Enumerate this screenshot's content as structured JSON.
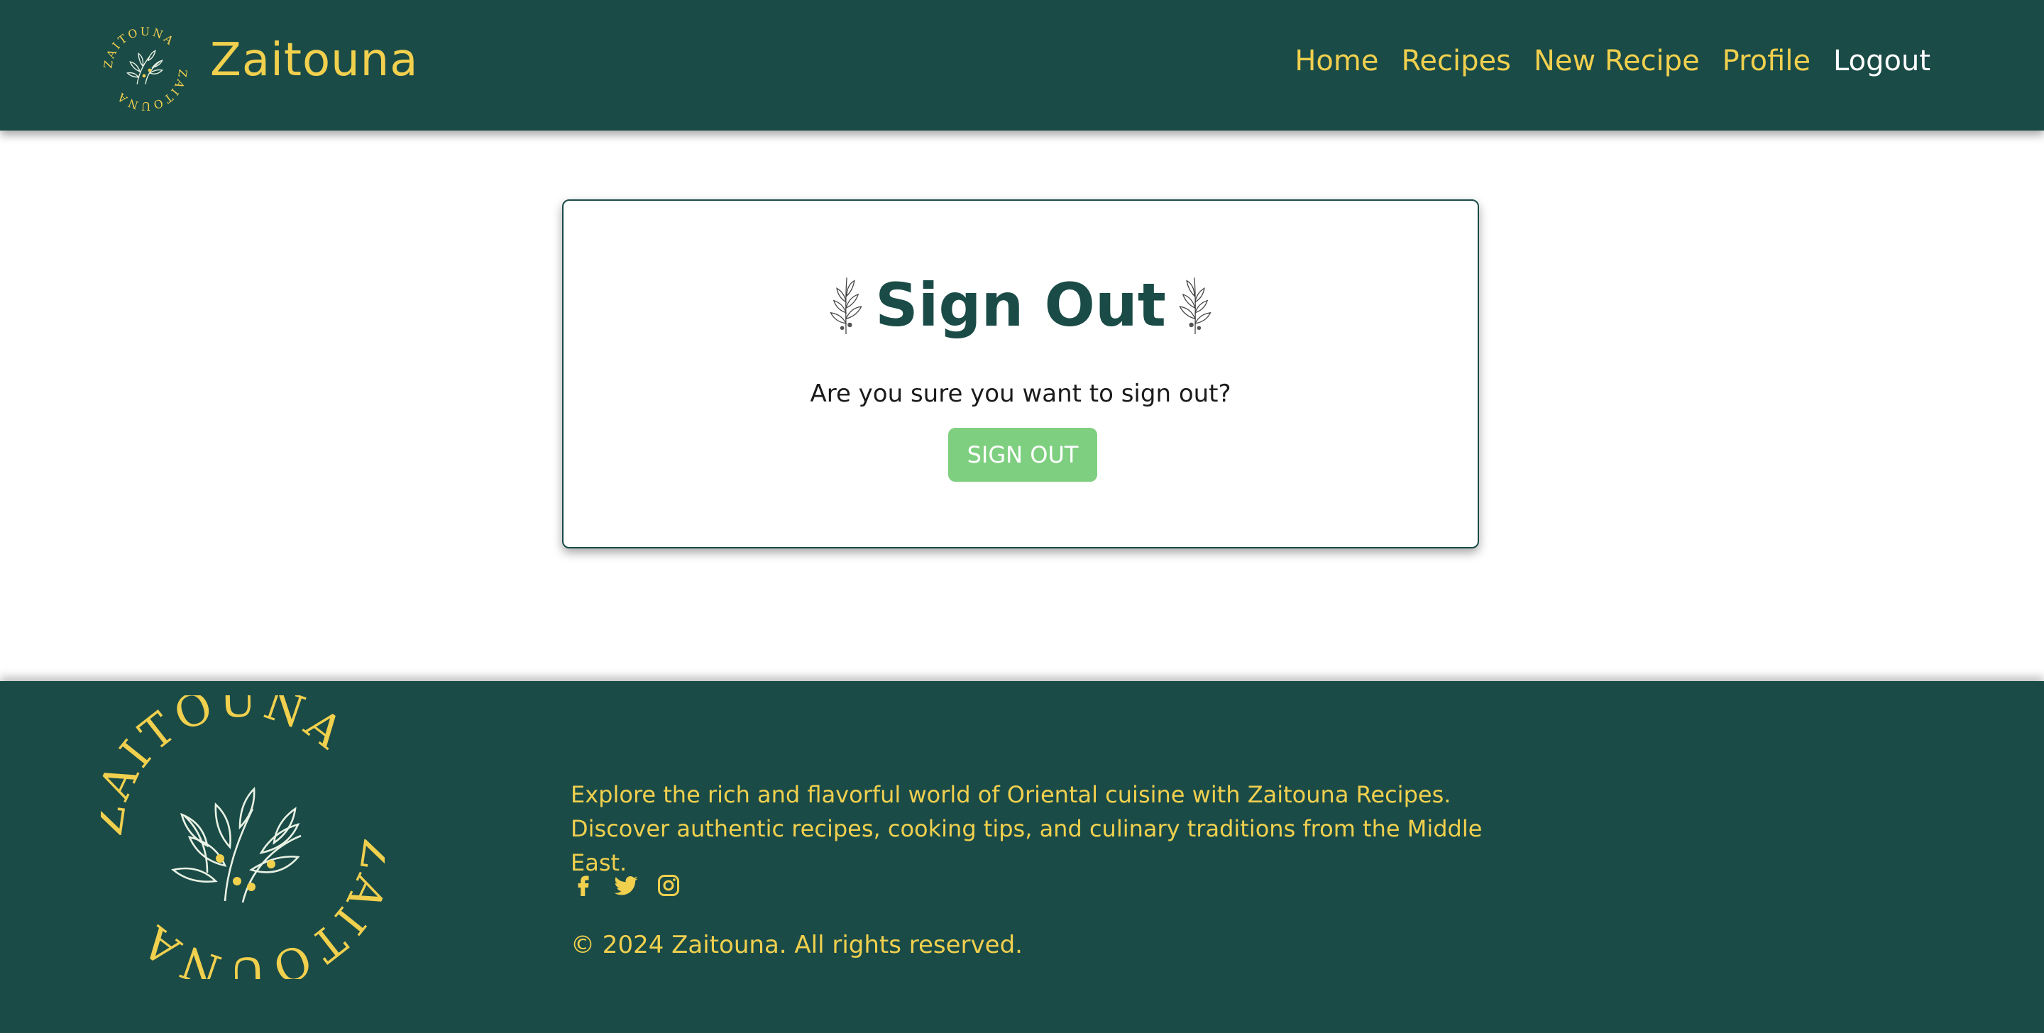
{
  "brand": {
    "name": "Zaitouna",
    "logo_text": "ZAITOUNA"
  },
  "nav": {
    "items": [
      {
        "label": "Home"
      },
      {
        "label": "Recipes"
      },
      {
        "label": "New Recipe"
      },
      {
        "label": "Profile"
      },
      {
        "label": "Logout"
      }
    ]
  },
  "card": {
    "title": "Sign Out",
    "question": "Are you sure you want to sign out?",
    "button_label": "SIGN OUT"
  },
  "footer": {
    "description": "Explore the rich and flavorful world of Oriental cuisine with Zaitouna Recipes. Discover authentic recipes, cooking tips, and culinary traditions from the Middle East.",
    "social": [
      "facebook-icon",
      "twitter-icon",
      "instagram-icon"
    ],
    "copyright": "© 2024 Zaitouna. All rights reserved."
  },
  "colors": {
    "primary": "#1a4b47",
    "accent": "#f1d04e",
    "button": "#7fcf80"
  }
}
